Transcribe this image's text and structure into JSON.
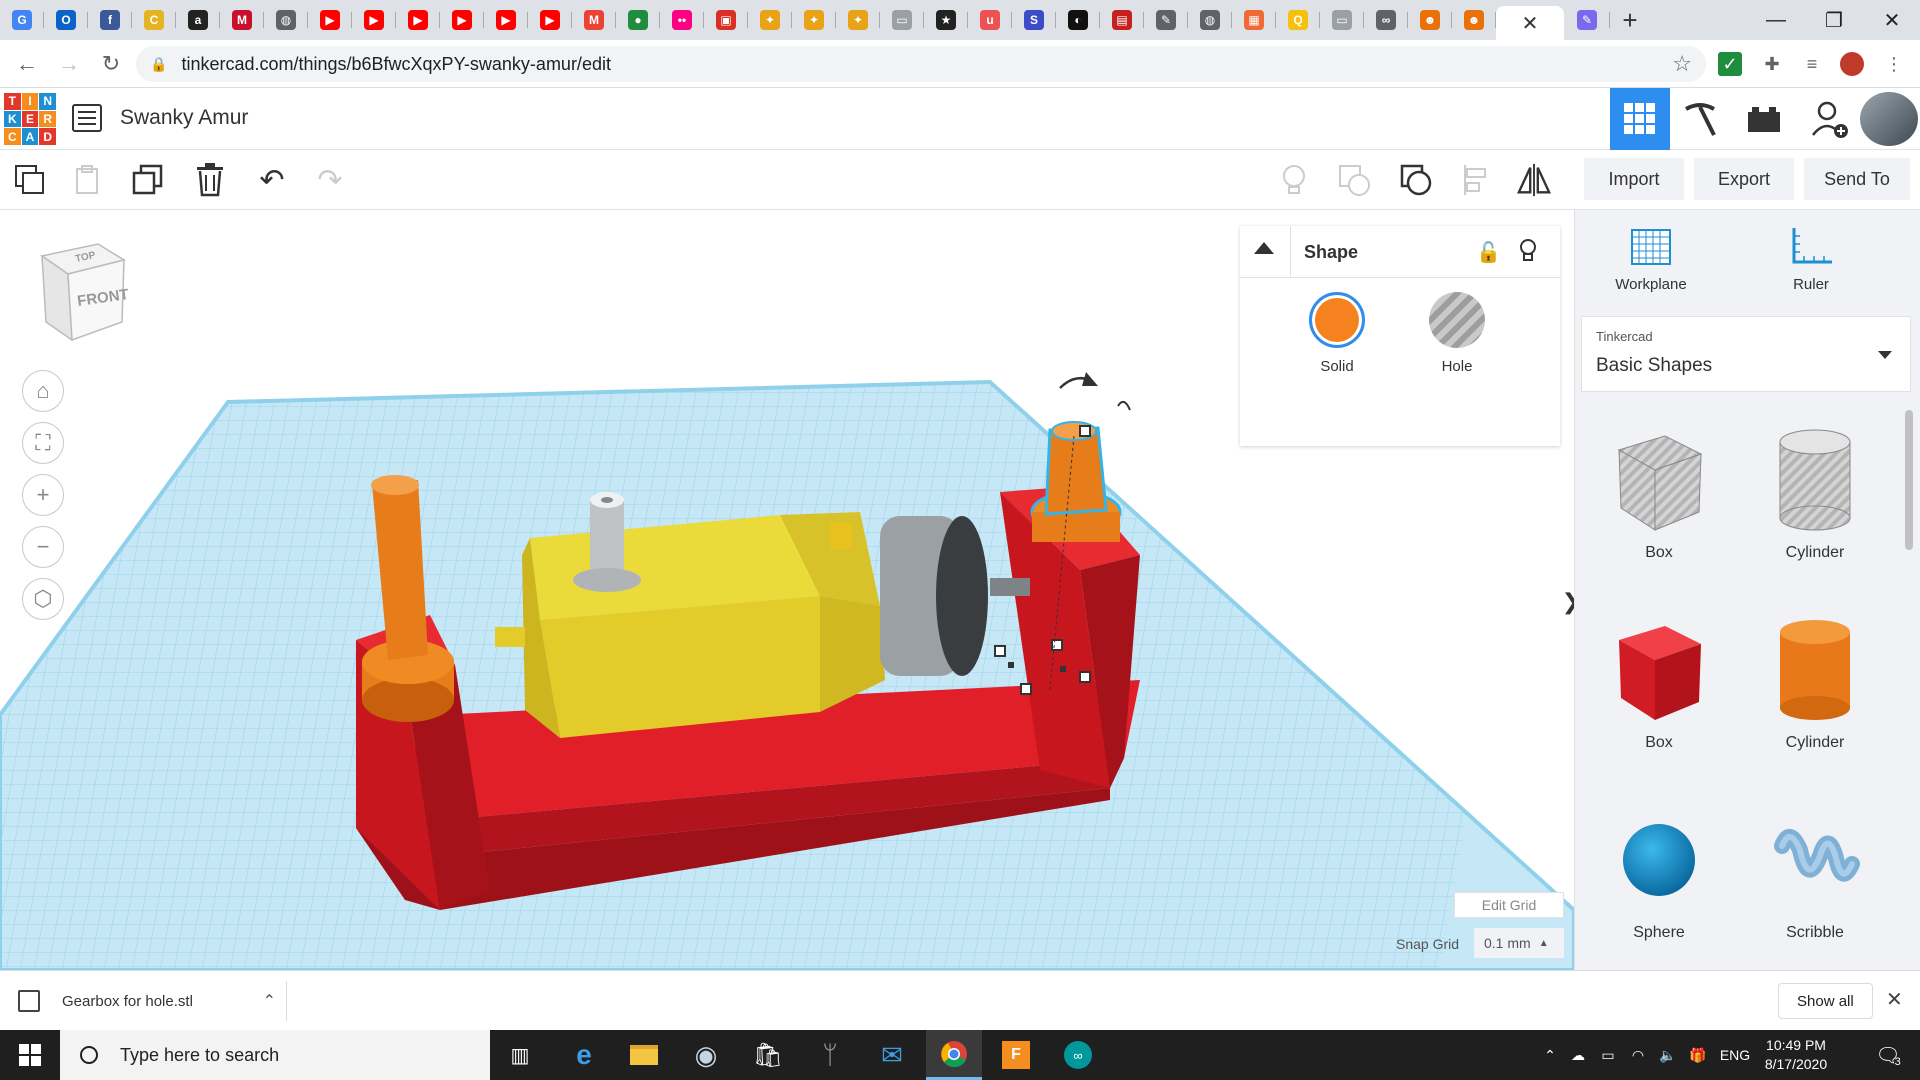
{
  "browser": {
    "tab_icons": [
      {
        "name": "google-docs-icon",
        "color": "#4285f4",
        "glyph": "G"
      },
      {
        "name": "outlook-icon",
        "color": "#0a64c8",
        "glyph": "O"
      },
      {
        "name": "facebook-icon",
        "color": "#3b5998",
        "glyph": "f"
      },
      {
        "name": "coin-icon",
        "color": "#e6b422",
        "glyph": "C"
      },
      {
        "name": "amazon-icon",
        "color": "#222222",
        "glyph": "a"
      },
      {
        "name": "mcmaster-icon",
        "color": "#c8102e",
        "glyph": "M"
      },
      {
        "name": "globe-icon",
        "color": "#5f6368",
        "glyph": "◍"
      },
      {
        "name": "youtube-icon",
        "color": "#ff0000",
        "glyph": "▶"
      },
      {
        "name": "youtube-icon",
        "color": "#ff0000",
        "glyph": "▶"
      },
      {
        "name": "youtube-icon",
        "color": "#ff0000",
        "glyph": "▶"
      },
      {
        "name": "youtube-icon",
        "color": "#ff0000",
        "glyph": "▶"
      },
      {
        "name": "youtube-icon",
        "color": "#ff0000",
        "glyph": "▶"
      },
      {
        "name": "youtube-icon",
        "color": "#ff0000",
        "glyph": "▶"
      },
      {
        "name": "gmail-icon",
        "color": "#ea4335",
        "glyph": "M"
      },
      {
        "name": "green-circle-icon",
        "color": "#1e8e3e",
        "glyph": "●"
      },
      {
        "name": "flickr-icon",
        "color": "#ff0084",
        "glyph": "••"
      },
      {
        "name": "red-app-icon",
        "color": "#d93025",
        "glyph": "▣"
      },
      {
        "name": "bulb-icon",
        "color": "#e8a317",
        "glyph": "✦"
      },
      {
        "name": "bulb-icon",
        "color": "#e8a317",
        "glyph": "✦"
      },
      {
        "name": "bulb-icon",
        "color": "#e8a317",
        "glyph": "✦"
      },
      {
        "name": "page-icon",
        "color": "#9aa0a6",
        "glyph": "▭"
      },
      {
        "name": "star-app-icon",
        "color": "#222222",
        "glyph": "★"
      },
      {
        "name": "udemy-icon",
        "color": "#ec5252",
        "glyph": "u"
      },
      {
        "name": "s-app-icon",
        "color": "#3c4bc8",
        "glyph": "S"
      },
      {
        "name": "dark-circle-icon",
        "color": "#111111",
        "glyph": "◐"
      },
      {
        "name": "keyboard-icon",
        "color": "#c5221f",
        "glyph": "▤"
      },
      {
        "name": "pen-icon",
        "color": "#5f6368",
        "glyph": "✎"
      },
      {
        "name": "globe-icon",
        "color": "#5f6368",
        "glyph": "◍"
      },
      {
        "name": "grid-app-icon",
        "color": "#f06a35",
        "glyph": "▦"
      },
      {
        "name": "yellow-app-icon",
        "color": "#f4c20d",
        "glyph": "Q"
      },
      {
        "name": "page-icon",
        "color": "#9aa0a6",
        "glyph": "▭"
      },
      {
        "name": "github-icon",
        "color": "#5f6368",
        "glyph": "∞"
      },
      {
        "name": "person-app-icon",
        "color": "#e8710a",
        "glyph": "☻"
      },
      {
        "name": "person-app-icon",
        "color": "#e8710a",
        "glyph": "☻"
      }
    ],
    "active_tab_close": "✕",
    "active_tab_icon_color": "#7b68ee",
    "new_tab": "+",
    "window_controls": {
      "minimize": "—",
      "maximize": "❐",
      "close": "✕"
    },
    "url": "tinkercad.com/things/b6BfwcXqxPY-swanky-amur/edit"
  },
  "app": {
    "logo_letters": [
      "T",
      "I",
      "N",
      "K",
      "E",
      "R",
      "C",
      "A",
      "D"
    ],
    "logo_colors": [
      "#e2372b",
      "#f58d1f",
      "#1d8fd3",
      "#1d8fd3",
      "#e2372b",
      "#f58d1f",
      "#f58d1f",
      "#1d8fd3",
      "#e2372b"
    ],
    "title": "Swanky Amur",
    "accent": "#2d8ef0"
  },
  "toolbar": {
    "import_label": "Import",
    "export_label": "Export",
    "send_to_label": "Send To"
  },
  "viewcube": {
    "top": "TOP",
    "front": "FRONT"
  },
  "shape_panel": {
    "title": "Shape",
    "solid_label": "Solid",
    "hole_label": "Hole",
    "solid_color": "#f5821f"
  },
  "grid": {
    "edit_label": "Edit Grid",
    "snap_label": "Snap Grid",
    "snap_value": "0.1 mm"
  },
  "sidebar": {
    "workplane_label": "Workplane",
    "ruler_label": "Ruler",
    "library_category": "Tinkercad",
    "library_value": "Basic Shapes",
    "shapes": [
      {
        "label": "Box",
        "kind": "box-hole"
      },
      {
        "label": "Cylinder",
        "kind": "cylinder-hole"
      },
      {
        "label": "Box",
        "kind": "box-red"
      },
      {
        "label": "Cylinder",
        "kind": "cylinder-orange"
      },
      {
        "label": "Sphere",
        "kind": "sphere-blue"
      },
      {
        "label": "Scribble",
        "kind": "scribble"
      }
    ]
  },
  "downloads": {
    "file_name": "Gearbox for hole.stl",
    "show_all": "Show all"
  },
  "taskbar": {
    "search_placeholder": "Type here to search",
    "language": "ENG",
    "time": "10:49 PM",
    "date": "8/17/2020",
    "notifications": "3"
  }
}
